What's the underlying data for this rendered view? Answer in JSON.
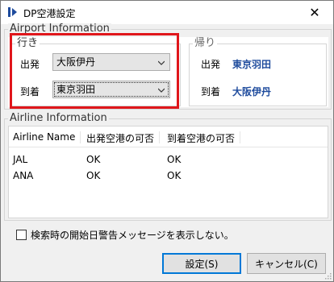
{
  "window": {
    "title": "DP空港設定",
    "close_glyph": "✕"
  },
  "airport": {
    "group_title": "Airport Information",
    "outbound": {
      "title": "行き",
      "departure_label": "出発",
      "departure_value": "大阪伊丹",
      "arrival_label": "到着",
      "arrival_value": "東京羽田"
    },
    "return": {
      "title": "帰り",
      "departure_label": "出発",
      "departure_value": "東京羽田",
      "arrival_label": "到着",
      "arrival_value": "大阪伊丹"
    }
  },
  "airline": {
    "group_title": "Airline Information",
    "columns": [
      "Airline Name",
      "出発空港の可否",
      "到着空港の可否"
    ],
    "rows": [
      [
        "JAL",
        "OK",
        "OK"
      ],
      [
        "ANA",
        "OK",
        "OK"
      ]
    ]
  },
  "checkbox": {
    "label": "検索時の開始日警告メッセージを表示しない。",
    "checked": false
  },
  "buttons": {
    "ok": "設定(S)",
    "cancel": "キャンセル(C)"
  },
  "colors": {
    "highlight_outline": "#e0161b",
    "return_value_text": "#1e4b9d",
    "primary_border": "#0078d7"
  }
}
